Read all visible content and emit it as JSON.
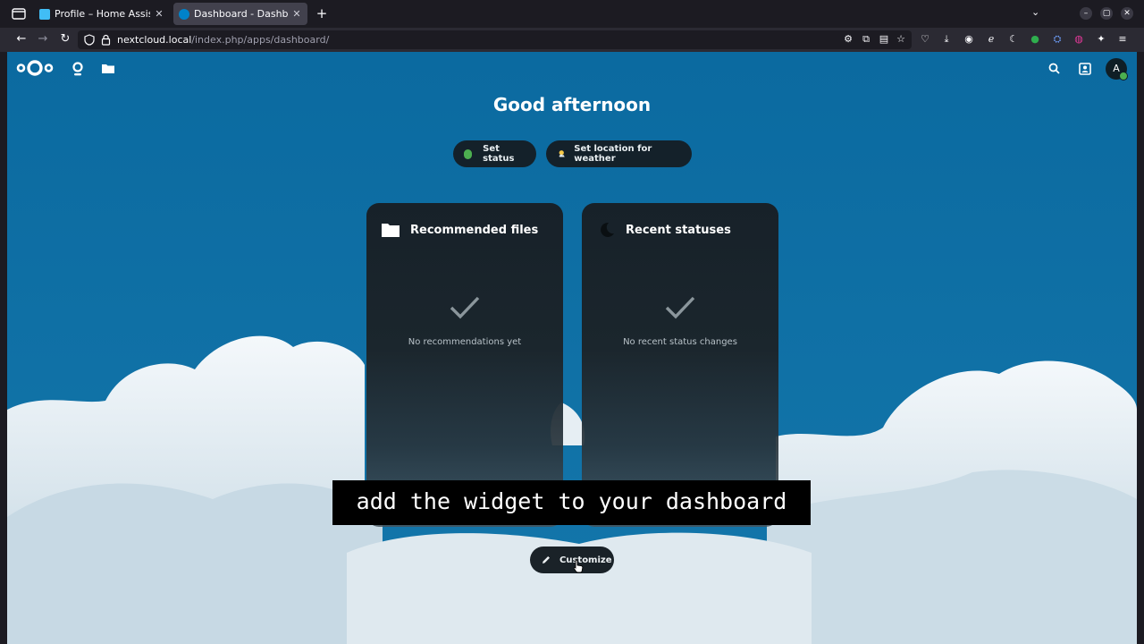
{
  "browser": {
    "tabs": [
      {
        "title": "Profile – Home Assistant",
        "active": false
      },
      {
        "title": "Dashboard - Dashboard - Nextcloud",
        "active": true
      }
    ],
    "new_tab_label": "+",
    "url_host": "nextcloud.local",
    "url_path": "/index.php/apps/dashboard/"
  },
  "dashboard": {
    "greeting": "Good afternoon",
    "set_status_label": "Set status",
    "set_weather_label": "Set location for weather",
    "widgets": [
      {
        "title": "Recommended files",
        "empty_text": "No recommendations yet"
      },
      {
        "title": "Recent statuses",
        "empty_text": "No recent status changes"
      }
    ],
    "customize_label": "Customize",
    "user_initial": "A"
  },
  "caption": {
    "text": "add the widget to your dashboard"
  },
  "colors": {
    "accent": "#0b6ca0",
    "status_online": "#4caf50",
    "panel": "#172129"
  }
}
